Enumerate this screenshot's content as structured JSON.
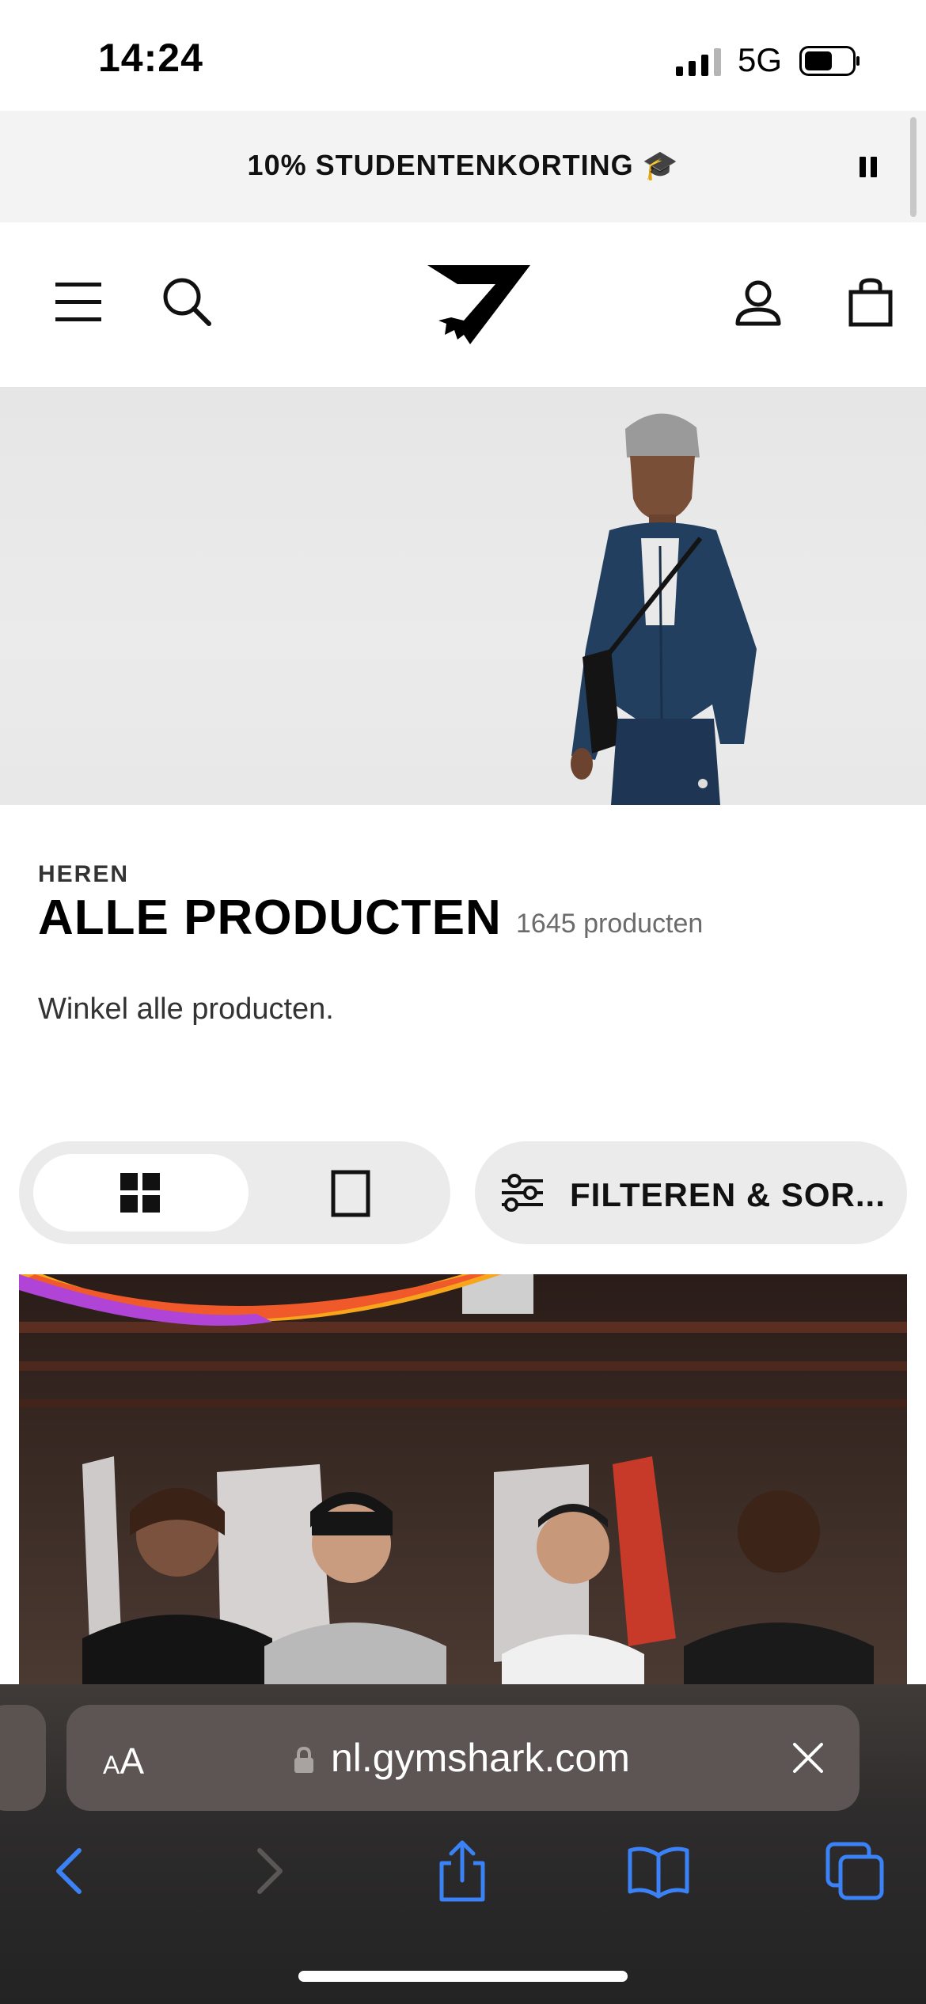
{
  "status_bar": {
    "time": "14:24",
    "network": "5G",
    "icons": [
      "signal-bars-icon",
      "battery-icon"
    ]
  },
  "promo_banner": {
    "text": "10% STUDENTENKORTING 🎓",
    "pause_icon": "pause-icon"
  },
  "header": {
    "icons": [
      "menu-icon",
      "search-icon",
      "gymshark-logo",
      "account-icon",
      "bag-icon"
    ]
  },
  "hero": {
    "image": "man-in-navy-zip-hoodie-and-grey-beanie"
  },
  "category": {
    "label": "HEREN",
    "title": "ALLE PRODUCTEN",
    "count": "1645 producten",
    "description": "Winkel alle producten."
  },
  "toolbar": {
    "view_grid_icon": "grid-view-icon",
    "view_single_icon": "single-view-icon",
    "filter_label": "FILTEREN & SOR...",
    "filter_icon": "sliders-icon"
  },
  "promo_image": {
    "description_icon": "campaign-photo"
  },
  "browser": {
    "aa_label_small": "A",
    "aa_label_large": "A",
    "url": "nl.gymshark.com",
    "nav_icons": [
      "back-icon",
      "forward-icon",
      "share-icon",
      "bookmarks-icon",
      "tabs-icon"
    ]
  },
  "colors": {
    "accent_blue": "#3b82f6",
    "promo_bg": "#f3f3f3",
    "toggle_bg": "#ebebeb"
  }
}
